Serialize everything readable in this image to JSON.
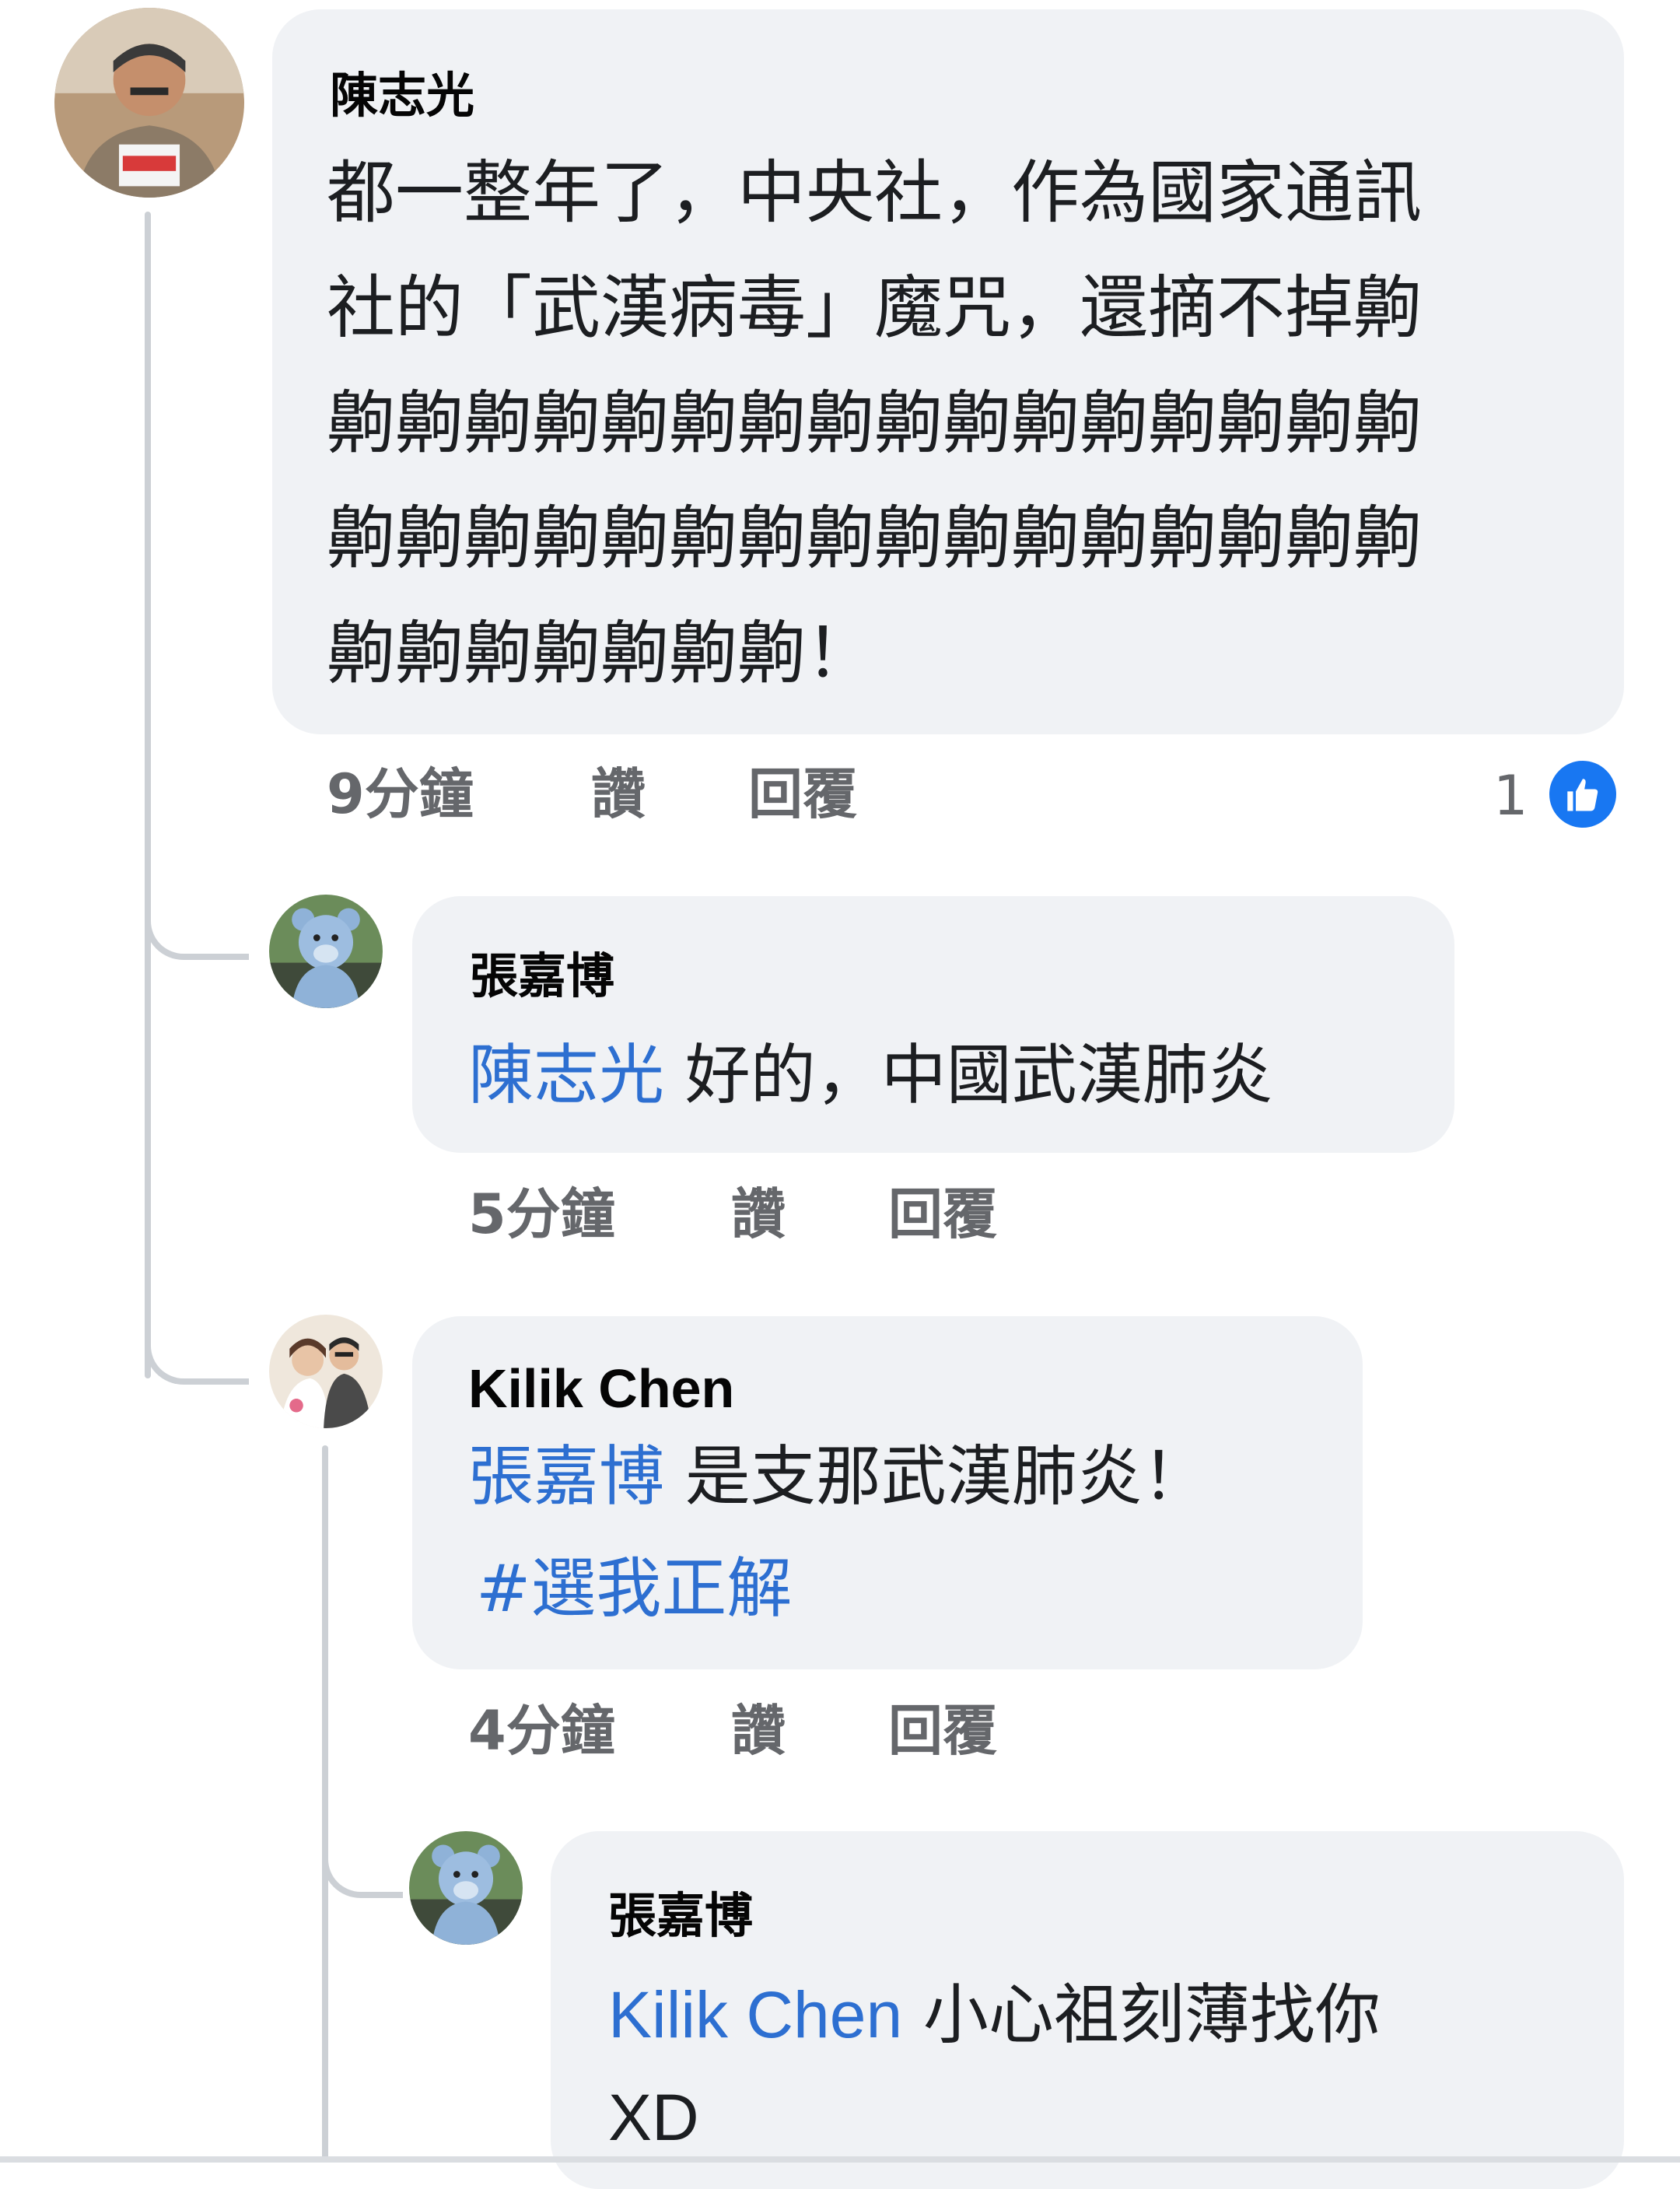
{
  "comments": [
    {
      "author": "陳志光",
      "lines": [
        "都一整年了，中央社，作為國家通訊",
        "社的「武漢病毒」魔咒，還摘不掉齁",
        "齁齁齁齁齁齁齁齁齁齁齁齁齁齁齁齁",
        "齁齁齁齁齁齁齁齁齁齁齁齁齁齁齁齁",
        "齁齁齁齁齁齁齁！"
      ],
      "time": "9分鐘",
      "like_label": "讚",
      "reply_label": "回覆",
      "reaction_count": "1",
      "reaction_icon": "thumbs-up-icon",
      "avatar_icon": "user-photo-older-man"
    },
    {
      "author": "張嘉博",
      "mention": "陳志光",
      "text": "好的，中國武漢肺炎",
      "time": "5分鐘",
      "like_label": "讚",
      "reply_label": "回覆",
      "avatar_icon": "user-photo-teddy-bear"
    },
    {
      "author": "Kilik Chen",
      "mention": "張嘉博",
      "text": "是支那武漢肺炎！",
      "hashtag": "#選我正解",
      "time": "4分鐘",
      "like_label": "讚",
      "reply_label": "回覆",
      "avatar_icon": "user-photo-couple"
    },
    {
      "author": "張嘉博",
      "mention": "Kilik Chen",
      "text": "小心祖刻薄找你",
      "text_line2": "XD",
      "avatar_icon": "user-photo-teddy-bear"
    }
  ],
  "colors": {
    "bubble": "#f0f2f5",
    "mention": "#2d6fd1",
    "meta": "#65676b",
    "like_blue": "#1877f2",
    "thread_line": "#ccd0d5"
  }
}
